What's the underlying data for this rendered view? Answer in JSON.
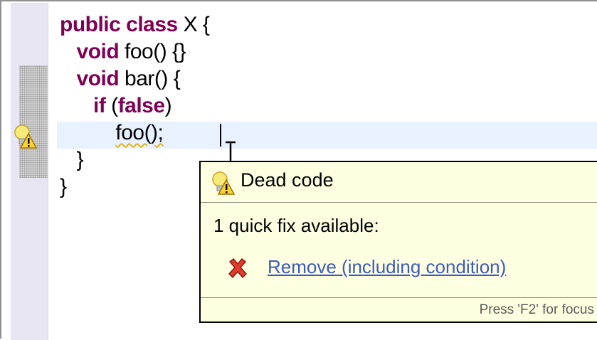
{
  "editor": {
    "code_lines": [
      {
        "indent": "",
        "keyword": "public class",
        "rest": " X {"
      },
      {
        "indent": "   ",
        "keyword": "void",
        "rest": " foo() {}"
      },
      {
        "indent": "   ",
        "keyword": "void",
        "rest": " bar() {"
      },
      {
        "indent": "      ",
        "keyword": "if",
        "rest_pre": " (",
        "keyword2": "false",
        "rest_post": ")"
      },
      {
        "indent": "          ",
        "dead_code": "foo();"
      },
      {
        "indent": "   ",
        "rest": "}"
      },
      {
        "indent": "",
        "rest": "}"
      }
    ],
    "warning_marker_icon": "lightbulb-warning-icon"
  },
  "popup": {
    "title": "Dead code",
    "title_icon": "lightbulb-warning-icon",
    "quickfix_count_text": "1 quick fix available:",
    "fixes": [
      {
        "icon": "red-x-icon",
        "label": "Remove (including condition)"
      }
    ],
    "status_text": "Press 'F2' for focus"
  },
  "colors": {
    "keyword": "#7f0055",
    "current_line": "#e8f1ff",
    "popup_bg": "#ffffe1",
    "link": "#3b59c2",
    "squiggly": "#e2b416"
  }
}
